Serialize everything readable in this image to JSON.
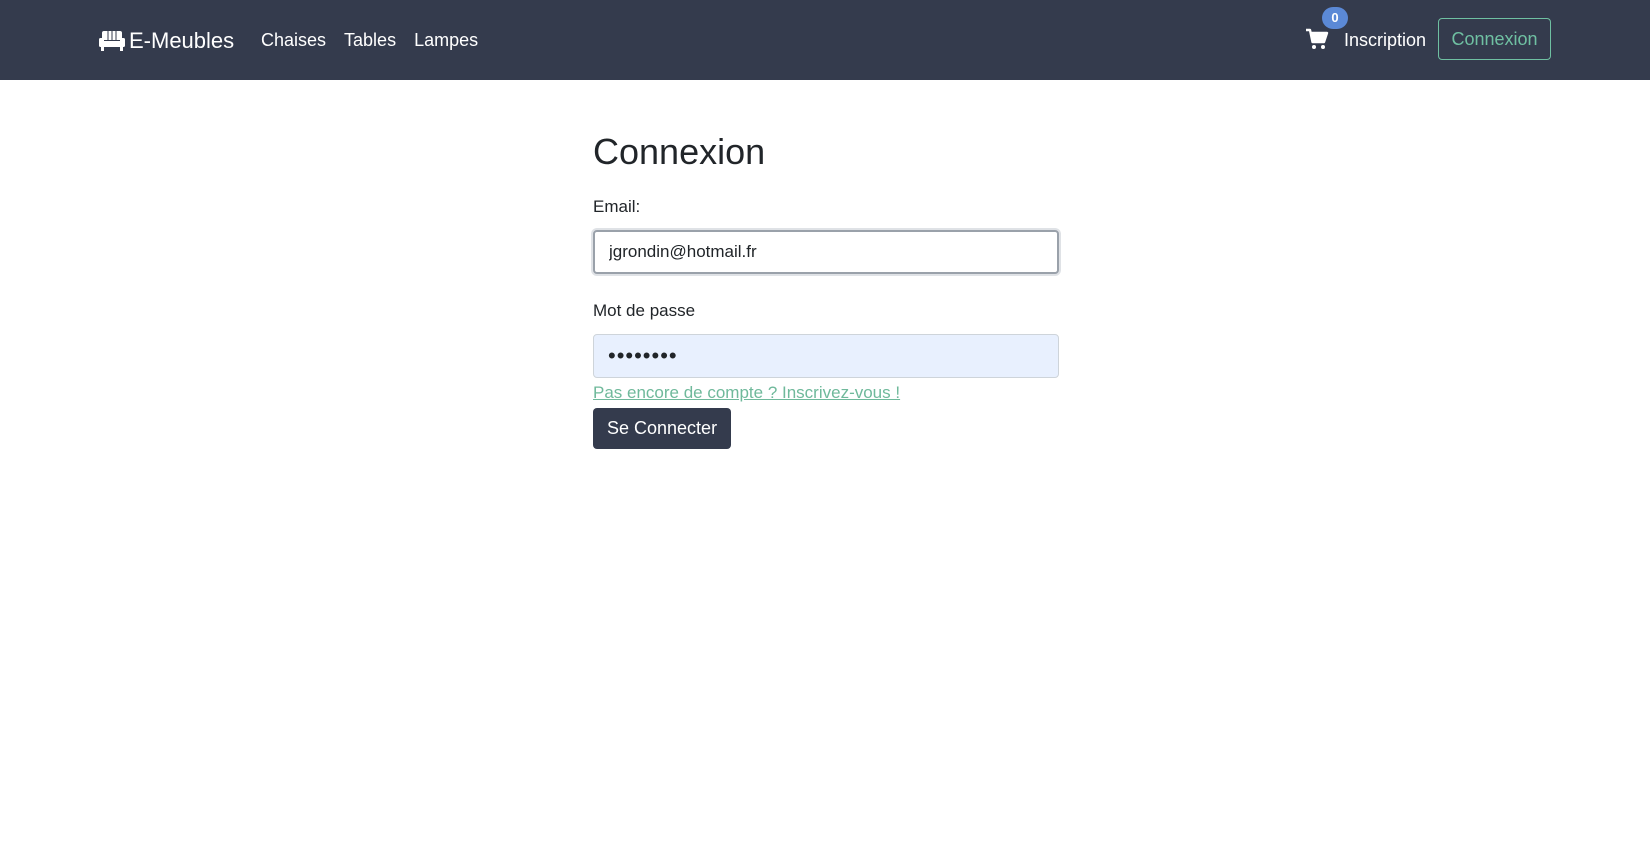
{
  "navbar": {
    "brand": "E-Meubles",
    "brand_icon": "couch-icon",
    "links": [
      "Chaises",
      "Tables",
      "Lampes"
    ],
    "cart_icon": "cart-icon",
    "cart_count": "0",
    "inscription": "Inscription",
    "connexion": "Connexion"
  },
  "form": {
    "title": "Connexion",
    "email_label": "Email:",
    "email_value": "jgrondin@hotmail.fr",
    "password_label": "Mot de passe",
    "password_value": "••••••••",
    "signup_link": "Pas encore de compte ? Inscrivez-vous !",
    "submit": "Se Connecter"
  },
  "colors": {
    "navbar_bg": "#343b4d",
    "accent": "#6fc0a2",
    "badge": "#5b89d6",
    "autofill_bg": "#e8f0fe"
  }
}
